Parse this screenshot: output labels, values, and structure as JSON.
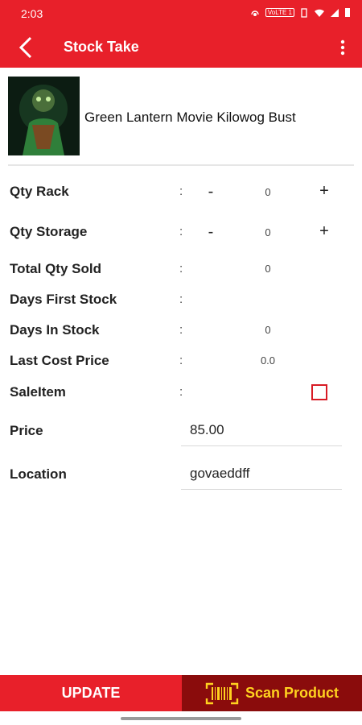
{
  "status": {
    "time": "2:03",
    "volte": "VoLTE 1"
  },
  "header": {
    "title": "Stock Take"
  },
  "product": {
    "name": "Green Lantern Movie Kilowog Bust"
  },
  "rows": [
    {
      "label": "Qty Rack",
      "colon": ":",
      "minus": "-",
      "value": "0",
      "plus": "+"
    },
    {
      "label": "Qty Storage",
      "colon": ":",
      "minus": "-",
      "value": "0",
      "plus": "+"
    },
    {
      "label": "Total Qty Sold",
      "colon": ":",
      "value": "0"
    },
    {
      "label": "Days First Stock",
      "colon": ":",
      "value": ""
    },
    {
      "label": "Days In Stock",
      "colon": ":",
      "value": "0"
    },
    {
      "label": "Last Cost Price",
      "colon": ":",
      "value": "0.0"
    },
    {
      "label": "SaleItem",
      "colon": ":",
      "checked": false
    }
  ],
  "price": {
    "label": "Price",
    "value": "85.00"
  },
  "location": {
    "label": "Location",
    "value": "govaeddff"
  },
  "actions": {
    "update": "UPDATE",
    "scan": "Scan Product"
  },
  "colors": {
    "primary": "#e8202a",
    "dark": "#8a0c0c",
    "accent": "#ffd21f"
  }
}
